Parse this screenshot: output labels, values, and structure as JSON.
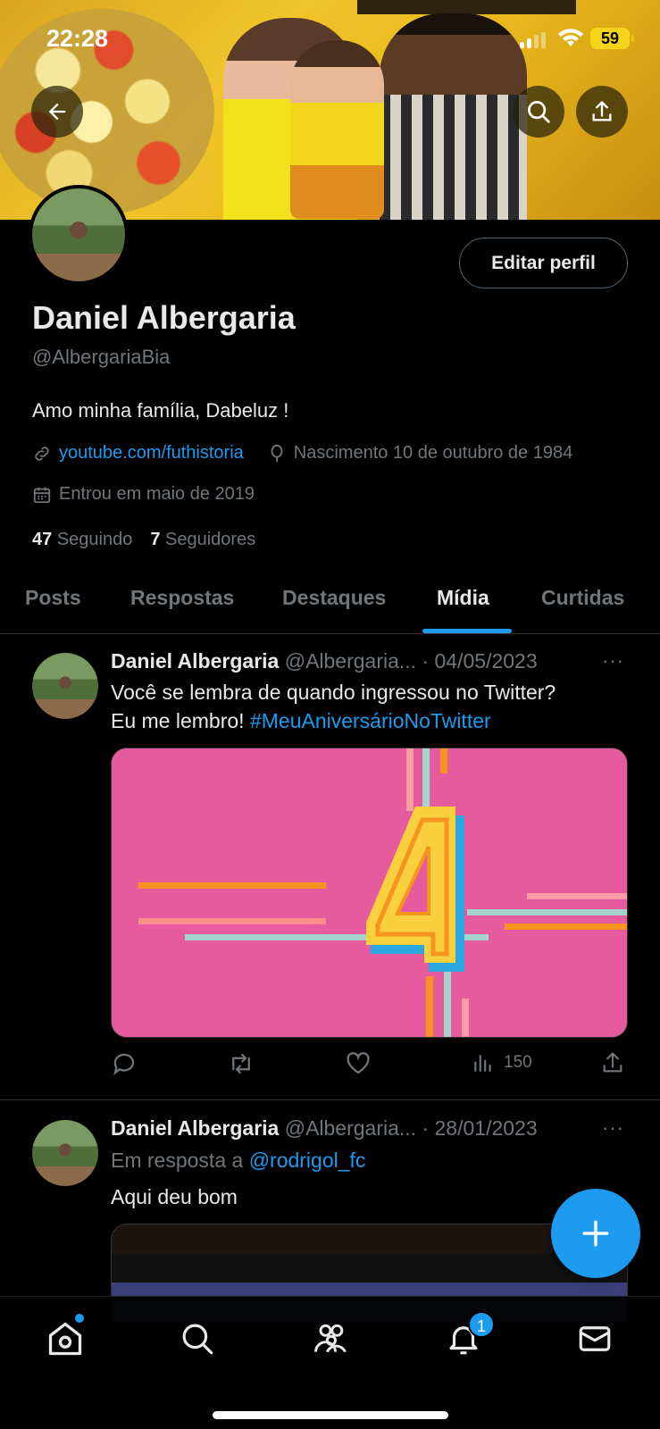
{
  "status_bar": {
    "time": "22:28",
    "battery": "59"
  },
  "profile": {
    "name": "Daniel Albergaria",
    "handle": "@AlbergariaBia",
    "bio": "Amo minha família, Dabeluz !",
    "link": "youtube.com/futhistoria",
    "birthday": "Nascimento 10 de outubro de 1984",
    "joined": "Entrou em maio de 2019",
    "following_count": "47",
    "following_label": "Seguindo",
    "followers_count": "7",
    "followers_label": "Seguidores",
    "edit_label": "Editar perfil"
  },
  "tabs": [
    {
      "label": "Posts"
    },
    {
      "label": "Respostas"
    },
    {
      "label": "Destaques"
    },
    {
      "label": "Mídia"
    },
    {
      "label": "Curtidas"
    }
  ],
  "active_tab": "Mídia",
  "posts": [
    {
      "name": "Daniel Albergaria",
      "handle_date": "@Albergaria... · 04/05/2023",
      "more": "···",
      "text_line1": "Você se lembra de quando ingressou no Twitter?",
      "text_line2": "Eu me lembro! ",
      "hashtag": "#MeuAniversárioNoTwitter",
      "views": "150"
    },
    {
      "name": "Daniel Albergaria",
      "handle_date": "@Albergaria... · 28/01/2023",
      "more": "···",
      "reply_prefix": "Em resposta a ",
      "reply_mention": "@rodrigol_fc",
      "text": "Aqui deu bom"
    }
  ],
  "bottom_nav": {
    "notifications_badge": "1"
  },
  "colors": {
    "accent": "#1d9bf0",
    "background": "#000000",
    "muted": "#71767b"
  }
}
